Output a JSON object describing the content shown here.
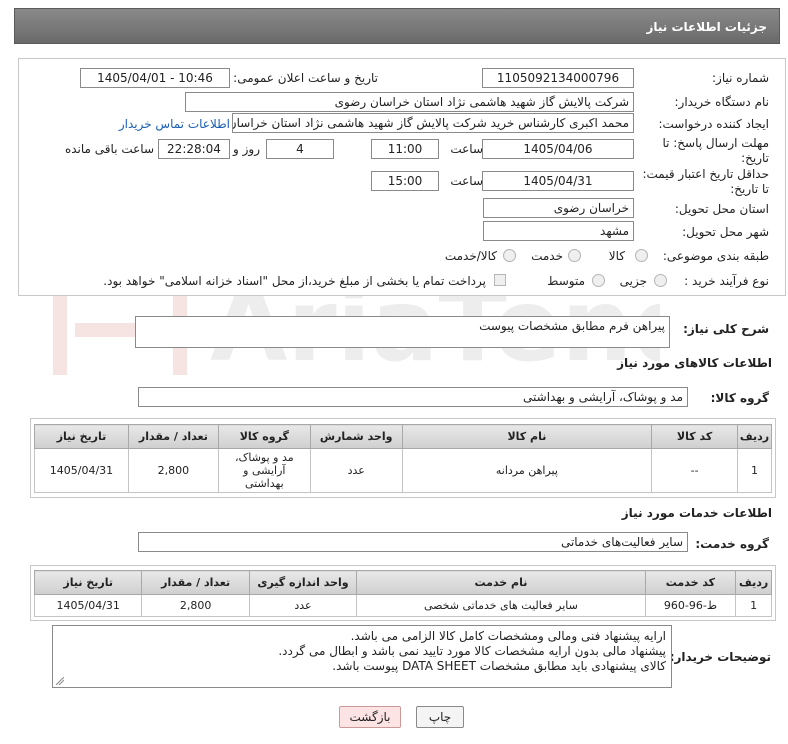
{
  "header": {
    "title": "جزئیات اطلاعات نیاز"
  },
  "form": {
    "need_number_label": "شماره نیاز:",
    "need_number": "1105092134000796",
    "announce_label": "تاریخ و ساعت اعلان عمومی:",
    "announce_value": "1405/04/01 - 10:46",
    "buyer_org_label": "نام دستگاه خریدار:",
    "buyer_org": "شرکت پالایش گاز شهید هاشمی نژاد   استان خراسان رضوی",
    "requester_label": "ایجاد کننده درخواست:",
    "requester": "محمد اکبری کارشناس خرید شرکت پالایش گاز شهید هاشمی نژاد   استان خراسان رضوی",
    "contact_link": "اطلاعات تماس خریدار",
    "reply_deadline_label": "مهلت ارسال پاسخ: تا تاریخ:",
    "reply_date": "1405/04/06",
    "hour_label": "ساعت",
    "reply_time": "11:00",
    "days_value": "4",
    "days_label": "روز و",
    "remaining_time": "22:28:04",
    "remaining_label": "ساعت باقی مانده",
    "price_validity_label": "حداقل تاریخ اعتبار قیمت: تا تاریخ:",
    "price_date": "1405/04/31",
    "price_time": "15:00",
    "province_label": "استان محل تحویل:",
    "province": "خراسان رضوی",
    "city_label": "شهر محل تحویل:",
    "city": "مشهد",
    "category_label": "طبقه بندی موضوعی:",
    "category_options": [
      "کالا",
      "خدمت",
      "کالا/خدمت"
    ],
    "process_label": "نوع فرآیند خرید :",
    "process_options": [
      "جزیی",
      "متوسط"
    ],
    "payment_text": "پرداخت تمام یا بخشی از مبلغ خرید،از محل \"اسناد خزانه اسلامی\" خواهد بود."
  },
  "summary": {
    "label": "شرح کلی نیاز:",
    "value": "پیراهن فرم مطابق مشخصات پیوست"
  },
  "goods": {
    "section_title": "اطلاعات کالاهای مورد نیاز",
    "group_label": "گروه کالا:",
    "group_value": "مد و پوشاک، آرایشی و بهداشتی",
    "headers": [
      "ردیف",
      "کد کالا",
      "نام کالا",
      "واحد شمارش",
      "گروه کالا",
      "تعداد / مقدار",
      "تاریخ نیاز"
    ],
    "rows": [
      {
        "row": "1",
        "code": "--",
        "name": "پیراهن مردانه",
        "unit": "عدد",
        "group_l1": "مد و پوشاک،",
        "group_l2": "آرایشی و",
        "group_l3": "بهداشتی",
        "qty": "2,800",
        "date": "1405/04/31"
      }
    ]
  },
  "services": {
    "section_title": "اطلاعات خدمات مورد نیاز",
    "group_label": "گروه خدمت:",
    "group_value": "سایر فعالیت‌های خدماتی",
    "headers": [
      "ردیف",
      "کد خدمت",
      "نام خدمت",
      "واحد اندازه گیری",
      "تعداد / مقدار",
      "تاریخ نیاز"
    ],
    "rows": [
      {
        "row": "1",
        "code": "ط-96-960",
        "name": "سایر فعالیت های خدماتی شخصی",
        "unit": "عدد",
        "qty": "2,800",
        "date": "1405/04/31"
      }
    ]
  },
  "buyer_notes": {
    "label": "توضیحات خریدار:",
    "line1": "ارایه پیشنهاد فنی ومالی ومشخصات کامل کالا الزامی می باشد.",
    "line2": "پیشنهاد مالی بدون ارایه مشخصات کالا مورد تایید نمی باشد و ابطال می گردد.",
    "line3": "کالای پیشنهادی باید مطابق مشخصات DATA SHEET پیوست باشد."
  },
  "buttons": {
    "print": "چاپ",
    "back": "بازگشت"
  },
  "watermark": {
    "text": "AriaTender.neT"
  },
  "colors": {
    "title_bg": "#777777",
    "link": "#1a5fb4",
    "back_button_bg": "#fde4e4"
  }
}
